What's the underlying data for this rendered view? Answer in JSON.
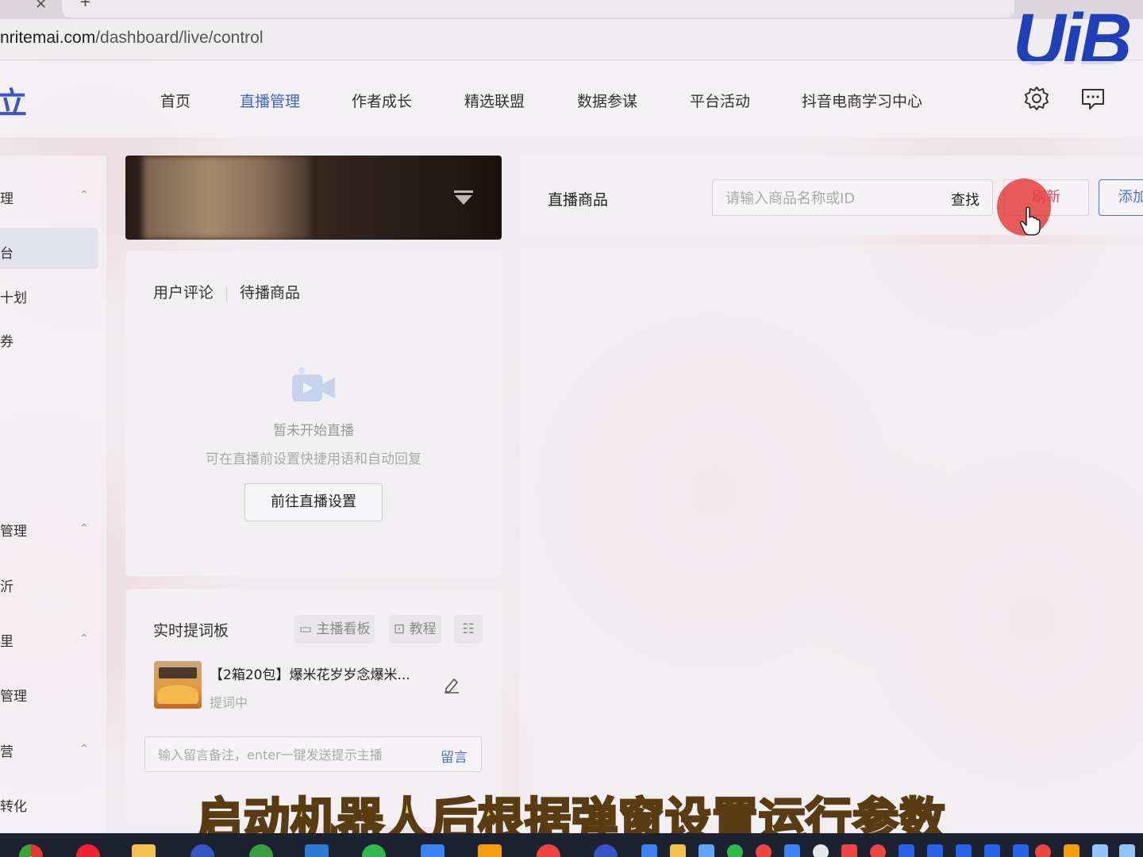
{
  "browser": {
    "url_host": "nritemai.com",
    "url_path": "/dashboard/live/control"
  },
  "watermark": {
    "logo_text": "UiB"
  },
  "topnav": {
    "brand_fragment": "立",
    "items": [
      {
        "label": "首页",
        "active": false
      },
      {
        "label": "直播管理",
        "active": true
      },
      {
        "label": "作者成长",
        "active": false
      },
      {
        "label": "精选联盟",
        "active": false
      },
      {
        "label": "数据参谋",
        "active": false
      },
      {
        "label": "平台活动",
        "active": false
      },
      {
        "label": "抖音电商学习中心",
        "active": false
      }
    ],
    "icons": [
      "settings-icon",
      "message-icon"
    ]
  },
  "sidebar": {
    "items": [
      {
        "label": "理",
        "chevron": "⌃"
      },
      {
        "label": "台",
        "active": true
      },
      {
        "label": "十划"
      },
      {
        "label": "券"
      },
      {
        "label": "管理",
        "chevron": "⌃"
      },
      {
        "label": "沂"
      },
      {
        "label": "里",
        "chevron": "⌃"
      },
      {
        "label": "管理"
      },
      {
        "label": "营",
        "chevron": "⌃"
      },
      {
        "label": "转化"
      }
    ]
  },
  "comments": {
    "tabs": [
      "用户评论",
      "待播商品"
    ],
    "empty_title": "暂未开始直播",
    "empty_subtitle": "可在直播前设置快捷用语和自动回复",
    "goto_button": "前往直播设置"
  },
  "prompt_board": {
    "title": "实时提词板",
    "chips": [
      "主播看板",
      "教程"
    ],
    "product_name": "【2箱20包】爆米花岁岁念爆米...",
    "product_status": "提词中",
    "note_placeholder": "输入留言备注，enter一键发送提示主播",
    "note_send": "留言"
  },
  "live_products": {
    "title": "直播商品",
    "search_placeholder": "请输入商品名称或ID",
    "search_button": "查找",
    "refresh_button": "刷新",
    "add_button": "添加"
  },
  "caption": "启动机器人后根据弹窗设置运行参数",
  "colors": {
    "accent": "#3f63d6",
    "caption": "#f2d64a",
    "click_indicator": "#e44040"
  }
}
